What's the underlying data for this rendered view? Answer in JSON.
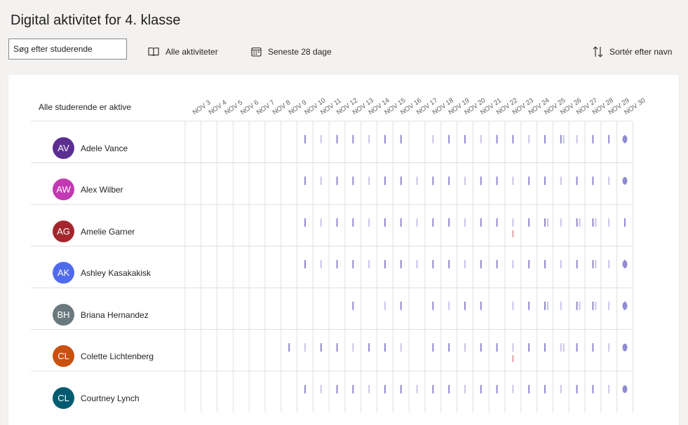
{
  "header": {
    "title": "Digital aktivitet for 4. klasse"
  },
  "toolbar": {
    "search_placeholder": "Søg efter studerende",
    "activities_label": "Alle aktiviteter",
    "period_label": "Seneste 28 dage",
    "sort_label": "Sortér efter navn"
  },
  "table": {
    "status_label": "Alle studerende er aktive",
    "dates": [
      "NOV 3",
      "NOV 4",
      "NOV 5",
      "NOV 6",
      "NOV 7",
      "NOV 8",
      "NOV 9",
      "NOV 10",
      "NOV 11",
      "NOV 12",
      "NOV 13",
      "NOV 14",
      "NOV 15",
      "NOV 16",
      "NOV 17",
      "NOV 18",
      "NOV 19",
      "NOV 20",
      "NOV 21",
      "NOV 22",
      "NOV 23",
      "NOV 24",
      "NOV 25",
      "NOV 26",
      "NOV 27",
      "NOV 28",
      "NOV 29",
      "NOV 30"
    ],
    "students": [
      {
        "initials": "AV",
        "name": "Adele Vance",
        "color": "#5c2e91",
        "activity_days": [
          7,
          8,
          9,
          10,
          11,
          12,
          13,
          15,
          16,
          17,
          18,
          19,
          20,
          21,
          22,
          23,
          24,
          25,
          26,
          27
        ],
        "multi_days": [
          23
        ],
        "today": true
      },
      {
        "initials": "AW",
        "name": "Alex Wilber",
        "color": "#c239b3",
        "activity_days": [
          7,
          8,
          9,
          10,
          11,
          12,
          13,
          14,
          15,
          16,
          17,
          18,
          19,
          20,
          21,
          22,
          23,
          24,
          25,
          26
        ],
        "multi_days": [],
        "today": true
      },
      {
        "initials": "AG",
        "name": "Amelie Garner",
        "color": "#a4262c",
        "activity_days": [
          7,
          8,
          9,
          10,
          11,
          12,
          13,
          14,
          15,
          16,
          17,
          18,
          19,
          20,
          21,
          22,
          23,
          24,
          25,
          26,
          27
        ],
        "multi_days": [
          22,
          24,
          25
        ],
        "flag_days": [
          20
        ],
        "today": false
      },
      {
        "initials": "AK",
        "name": "Ashley Kasakakisk",
        "color": "#4f6bed",
        "activity_days": [
          7,
          8,
          9,
          10,
          11,
          12,
          13,
          14,
          15,
          16,
          17,
          18,
          19,
          20,
          21,
          22,
          23,
          24,
          25,
          26,
          27
        ],
        "multi_days": [
          25
        ],
        "today": true
      },
      {
        "initials": "BH",
        "name": "Briana Hernandez",
        "color": "#69797e",
        "activity_days": [
          10,
          12,
          13,
          15,
          16,
          17,
          18,
          20,
          21,
          22,
          23,
          24,
          25,
          26,
          27
        ],
        "multi_days": [
          22,
          24,
          25
        ],
        "today": true
      },
      {
        "initials": "CL",
        "name": "Colette Lichtenberg",
        "color": "#ca5010",
        "activity_days": [
          6,
          7,
          8,
          9,
          10,
          11,
          12,
          13,
          15,
          16,
          17,
          18,
          19,
          20,
          21,
          22,
          23,
          24,
          25,
          26
        ],
        "multi_days": [
          23
        ],
        "flag_days": [
          20
        ],
        "today": true
      },
      {
        "initials": "CL",
        "name": "Courtney Lynch",
        "color": "#005b70",
        "activity_days": [
          7,
          8,
          9,
          10,
          11,
          12,
          13,
          14,
          15,
          16,
          17,
          18,
          19,
          20,
          21,
          22,
          23,
          24,
          25,
          26
        ],
        "multi_days": [],
        "today": true
      }
    ]
  },
  "colors": {
    "activity": "#8f8ccf",
    "activity_light": "#c8c6ec",
    "flag": "#e3a3a3",
    "grid": "#e1dfdd"
  }
}
